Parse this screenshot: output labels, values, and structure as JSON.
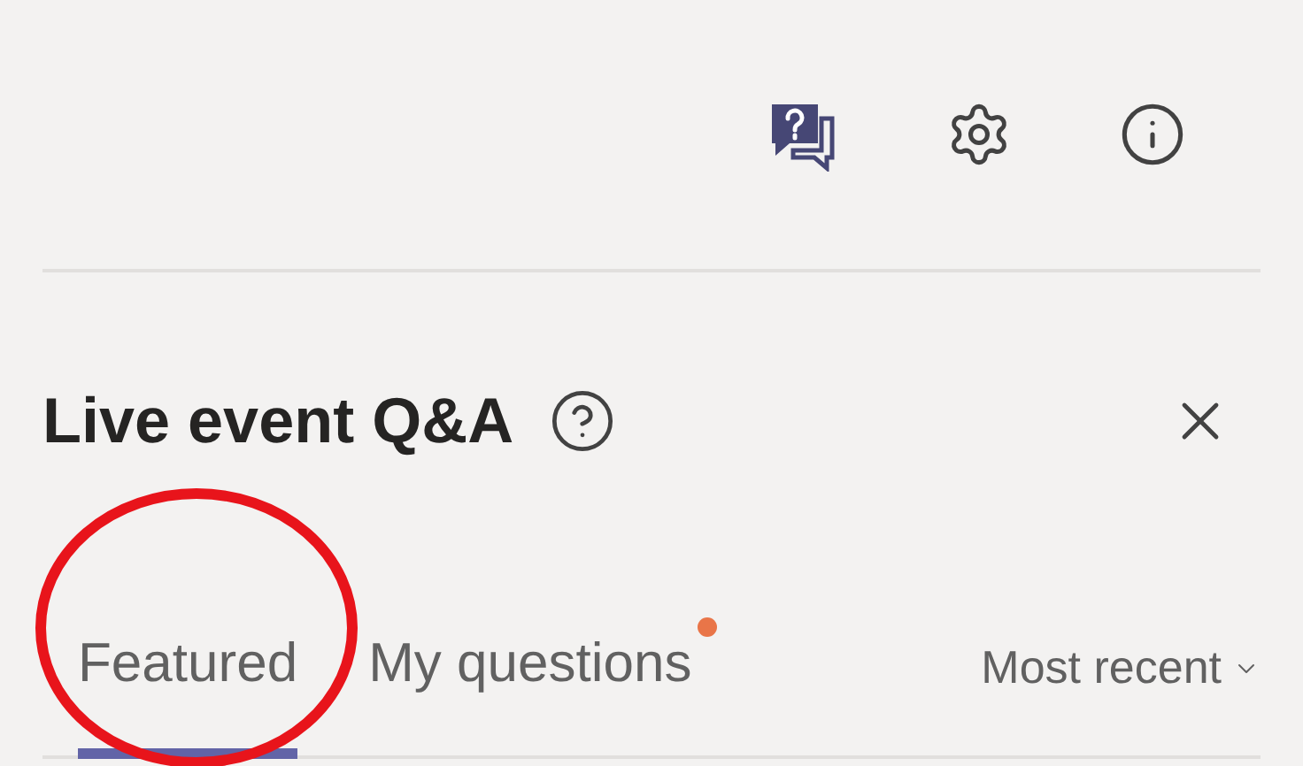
{
  "panel": {
    "title": "Live event Q&A"
  },
  "tabs": [
    {
      "label": "Featured",
      "selected": true,
      "unread": false
    },
    {
      "label": "My questions",
      "selected": false,
      "unread": true
    }
  ],
  "sort": {
    "label": "Most recent"
  },
  "annotation": {
    "kind": "circle"
  }
}
